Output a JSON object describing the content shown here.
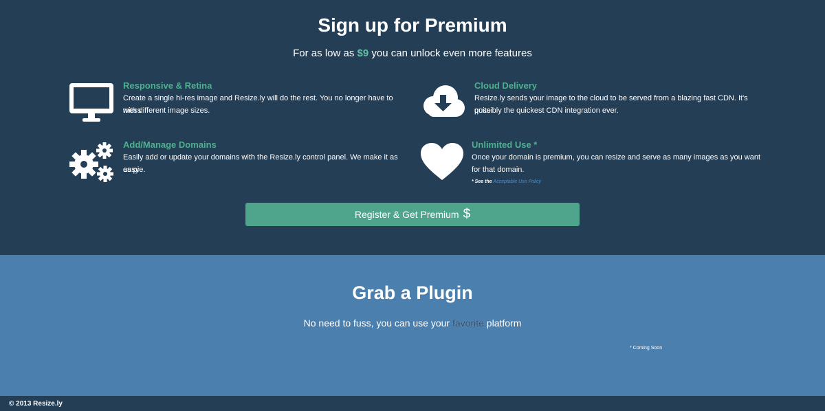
{
  "premium": {
    "title": "Sign up for Premium",
    "subtitle_before": "For as low as",
    "price": "$9",
    "subtitle_after": "you can unlock even more features",
    "features": [
      {
        "icon": "monitor-icon",
        "title": "Responsive & Retina",
        "text_line1": "Create a single hi-res image and Resize.ly will do the rest. You no longer have to mess",
        "text_line2": "with different image sizes."
      },
      {
        "icon": "cloud-download-icon",
        "title": "Cloud Delivery",
        "text_line1": "Resize.ly sends your image to the cloud to be served from a blazing fast CDN. It's quite",
        "text_line2": "possibly the quickest CDN integration ever."
      },
      {
        "icon": "gears-icon",
        "title": "Add/Manage Domains",
        "text_line1": "Easily add or update your domains with the Resize.ly control panel. We make it as easy",
        "text_line2": "as pie."
      },
      {
        "icon": "heart-icon",
        "title": "Unlimited Use *",
        "text_line1": "Once your domain is premium, you can resize and serve as many images as you want",
        "text_line2": "for that domain.",
        "note_prefix": "* See the",
        "note_link": "Acceptable Use Policy"
      }
    ],
    "register_label": "Register & Get Premium",
    "register_symbol": "$"
  },
  "plugins": {
    "title": "Grab a Plugin",
    "tagline_before": "No need to fuss, you can use your",
    "tagline_highlight": "favorite",
    "tagline_after": "platform",
    "coming_soon": "* Coming Soon"
  },
  "footer": {
    "copyright": "© 2013 Resize.ly"
  },
  "colors": {
    "dark_bg": "#243e56",
    "blue_bg": "#4b7fae",
    "accent_green": "#4ea58c",
    "title_green": "#4fb08f",
    "link_blue": "#4b8fd1"
  }
}
